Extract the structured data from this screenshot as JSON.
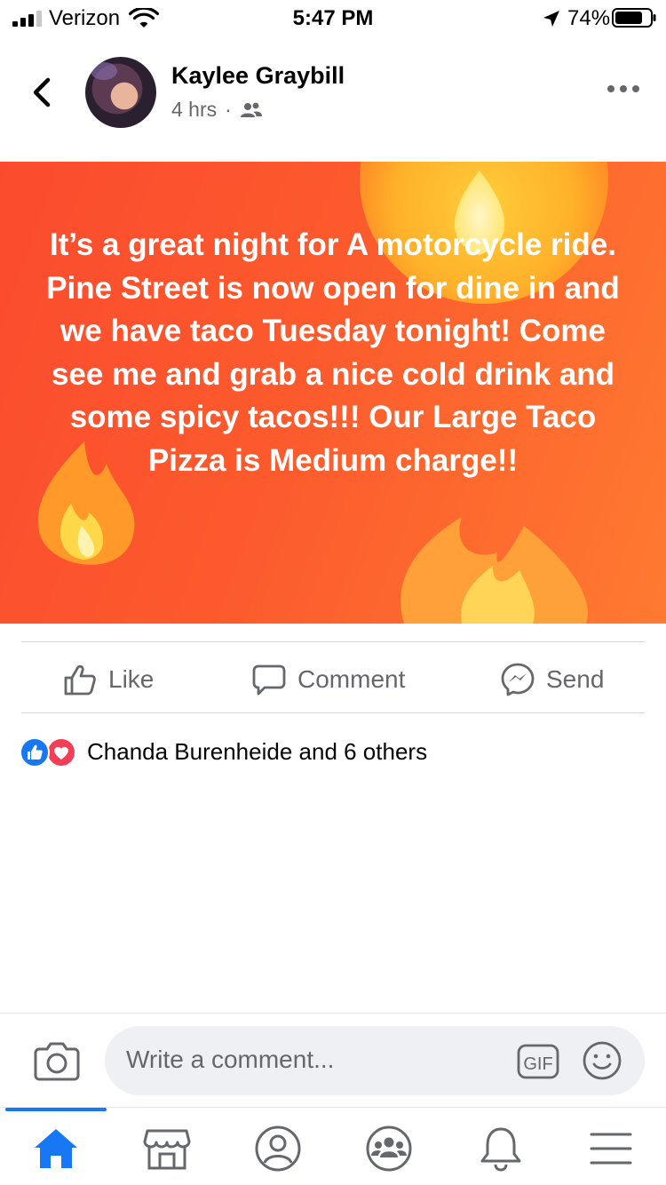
{
  "status_bar": {
    "carrier": "Verizon",
    "time": "5:47 PM",
    "battery": "74%"
  },
  "post": {
    "author": "Kaylee Graybill",
    "timestamp": "4 hrs",
    "separator": "·",
    "audience_icon": "friends-icon",
    "text": "It’s a great night for A motorcycle ride. Pine Street is now open for dine in and we have taco Tuesday tonight! Come see me and grab a nice cold drink and some spicy tacos!!! Our Large Taco Pizza is Medium charge!!",
    "background_colors": [
      "#fb4b2e",
      "#ff7a30"
    ]
  },
  "actions": {
    "like": "Like",
    "comment": "Comment",
    "send": "Send"
  },
  "reactions": {
    "summary": "Chanda Burenheide and 6 others",
    "icons": [
      "like-reaction-icon",
      "love-reaction-icon"
    ]
  },
  "comment_bar": {
    "placeholder": "Write a comment...",
    "gif_label": "GIF"
  },
  "nav": {
    "items": [
      "home-icon",
      "marketplace-icon",
      "profile-icon",
      "groups-icon",
      "notifications-icon",
      "menu-icon"
    ],
    "active": "home-icon",
    "accent": "#1877f2"
  }
}
